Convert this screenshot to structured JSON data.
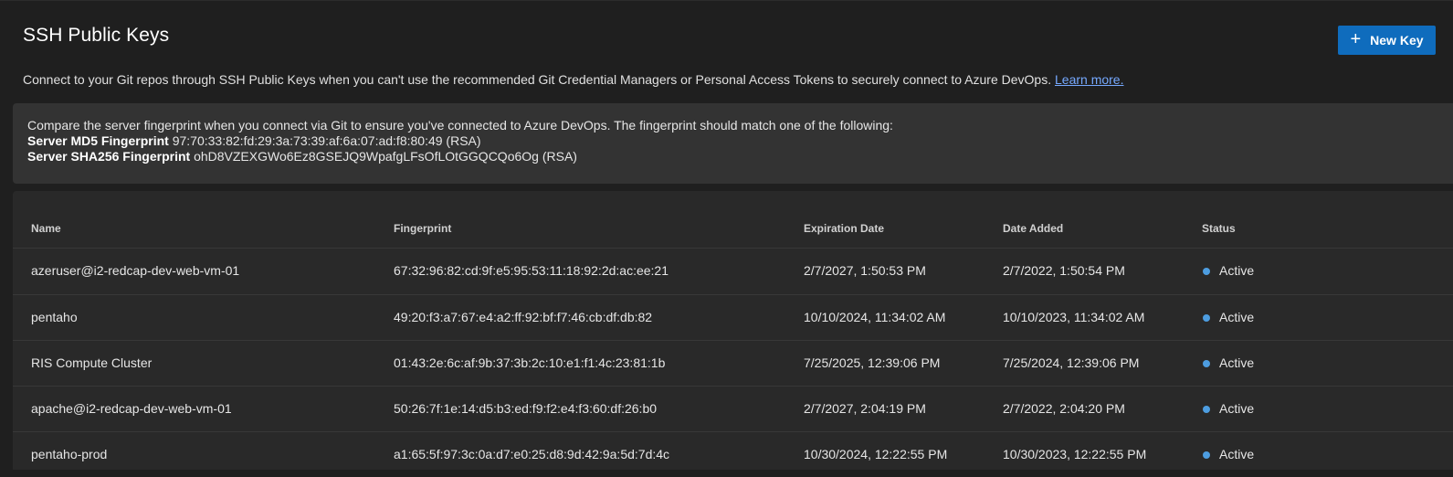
{
  "page": {
    "title": "SSH Public Keys",
    "new_key_label": "New Key",
    "description": "Connect to your Git repos through SSH Public Keys when you can't use the recommended Git Credential Managers or Personal Access Tokens to securely connect to Azure DevOps.",
    "learn_more": "Learn more."
  },
  "fingerprint_info": {
    "intro": "Compare the server fingerprint when you connect via Git to ensure you've connected to Azure DevOps. The fingerprint should match one of the following:",
    "md5_label": "Server MD5 Fingerprint",
    "md5_value": "97:70:33:82:fd:29:3a:73:39:af:6a:07:ad:f8:80:49 (RSA)",
    "sha256_label": "Server SHA256 Fingerprint",
    "sha256_value": "ohD8VZEXGWo6Ez8GSEJQ9WpafgLFsOfLOtGGQCQo6Og (RSA)"
  },
  "table": {
    "headers": {
      "name": "Name",
      "fingerprint": "Fingerprint",
      "expiration": "Expiration Date",
      "added": "Date Added",
      "status": "Status"
    },
    "status_color": "#4d9de0",
    "rows": [
      {
        "name": "azeruser@i2-redcap-dev-web-vm-01",
        "fingerprint": "67:32:96:82:cd:9f:e5:95:53:11:18:92:2d:ac:ee:21",
        "expiration": "2/7/2027, 1:50:53 PM",
        "added": "2/7/2022, 1:50:54 PM",
        "status": "Active"
      },
      {
        "name": "pentaho",
        "fingerprint": "49:20:f3:a7:67:e4:a2:ff:92:bf:f7:46:cb:df:db:82",
        "expiration": "10/10/2024, 11:34:02 AM",
        "added": "10/10/2023, 11:34:02 AM",
        "status": "Active"
      },
      {
        "name": "RIS Compute Cluster",
        "fingerprint": "01:43:2e:6c:af:9b:37:3b:2c:10:e1:f1:4c:23:81:1b",
        "expiration": "7/25/2025, 12:39:06 PM",
        "added": "7/25/2024, 12:39:06 PM",
        "status": "Active"
      },
      {
        "name": "apache@i2-redcap-dev-web-vm-01",
        "fingerprint": "50:26:7f:1e:14:d5:b3:ed:f9:f2:e4:f3:60:df:26:b0",
        "expiration": "2/7/2027, 2:04:19 PM",
        "added": "2/7/2022, 2:04:20 PM",
        "status": "Active"
      },
      {
        "name": "pentaho-prod",
        "fingerprint": "a1:65:5f:97:3c:0a:d7:e0:25:d8:9d:42:9a:5d:7d:4c",
        "expiration": "10/30/2024, 12:22:55 PM",
        "added": "10/30/2023, 12:22:55 PM",
        "status": "Active"
      }
    ]
  }
}
